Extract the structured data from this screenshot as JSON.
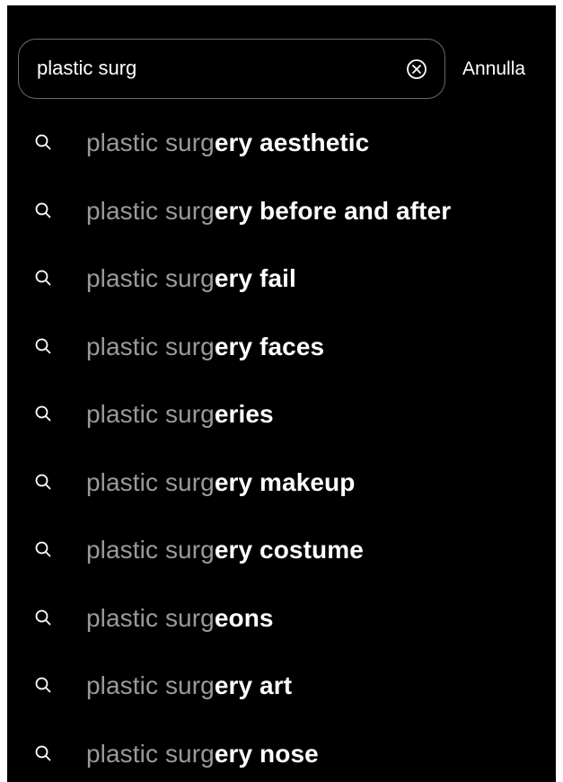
{
  "search": {
    "value": "plastic surg",
    "clear_icon": "circle-x-icon",
    "cancel_label": "Annulla"
  },
  "suggestions": [
    {
      "typed": "plastic surg",
      "completion": "ery aesthetic"
    },
    {
      "typed": "plastic surg",
      "completion": "ery before and after"
    },
    {
      "typed": "plastic surg",
      "completion": "ery fail"
    },
    {
      "typed": "plastic surg",
      "completion": "ery faces"
    },
    {
      "typed": "plastic surg",
      "completion": "eries"
    },
    {
      "typed": "plastic surg",
      "completion": "ery makeup"
    },
    {
      "typed": "plastic surg",
      "completion": "ery costume"
    },
    {
      "typed": "plastic surg",
      "completion": "eons"
    },
    {
      "typed": "plastic surg",
      "completion": "ery art"
    },
    {
      "typed": "plastic surg",
      "completion": "ery nose"
    }
  ],
  "suggestion_icon": "search-icon",
  "colors": {
    "background": "#000000",
    "typed_text": "#9a9a9a",
    "completion_text": "#ffffff",
    "border": "#6a6a6a"
  }
}
